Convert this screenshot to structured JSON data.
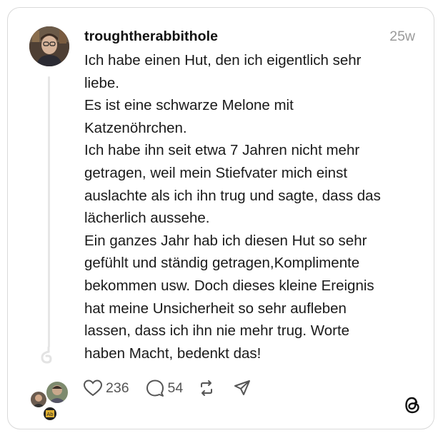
{
  "post": {
    "username": "troughtherabbithole",
    "time_ago": "25w",
    "lines": [
      "Ich habe einen Hut, den ich eigentlich sehr",
      "liebe.",
      "Es ist eine schwarze Melone mit",
      "Katzenöhrchen.",
      "Ich habe ihn seit etwa 7 Jahren nicht mehr",
      "getragen, weil mein Stiefvater mich einst",
      "auslachte als ich ihn trug und sagte, dass das",
      "lächerlich aussehe.",
      "Ein ganzes Jahr hab ich diesen Hut so sehr",
      "gefühlt und ständig getragen,Komplimente",
      "bekommen usw. Doch dieses kleine Ereignis",
      "hat meine Unsicherheit so sehr aufleben",
      "lassen, dass ich ihn nie mehr trug. Worte",
      "haben  Macht, bedenkt das!"
    ]
  },
  "actions": {
    "like_count": "236",
    "comment_count": "54",
    "icons": [
      "heart-icon",
      "comment-icon",
      "repost-icon",
      "share-icon"
    ]
  },
  "brand": {
    "logo": "threads-logo-icon"
  },
  "colors": {
    "text": "#1a1a1a",
    "muted": "#9a9a9a",
    "border": "#d9d9d9"
  }
}
